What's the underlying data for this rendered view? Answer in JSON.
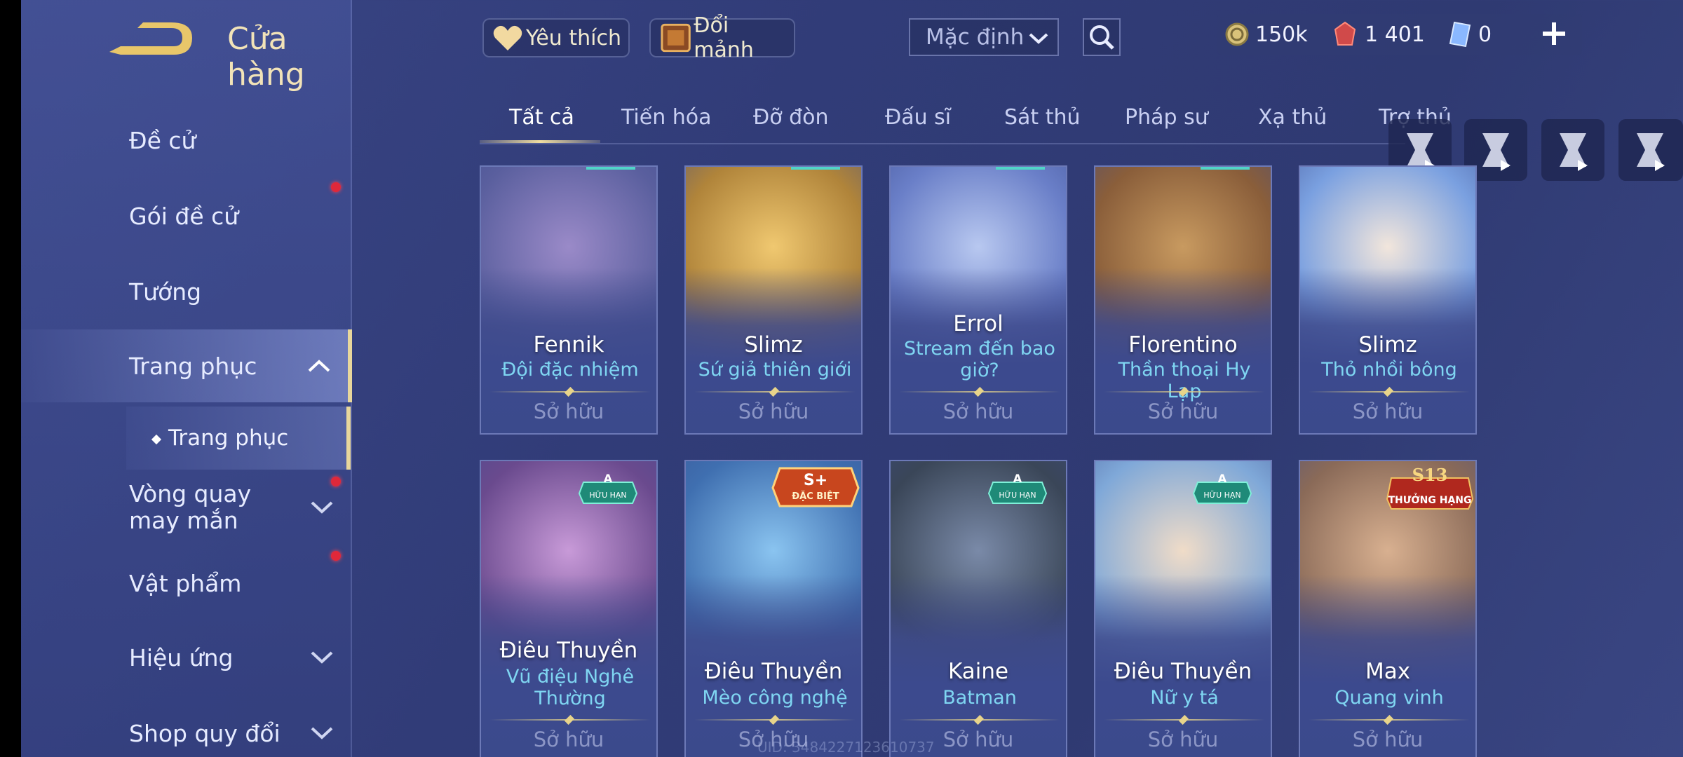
{
  "header": {
    "title": "Cửa hàng",
    "favorite_label": "Yêu thích",
    "exchange_label": "Đổi mảnh",
    "sort_value": "Mặc định",
    "currencies": {
      "gold": "150k",
      "vouchers": "1 401",
      "tokens": "0"
    }
  },
  "sidebar": {
    "items": [
      {
        "label": "Đề cử"
      },
      {
        "label": "Gói đề cử"
      },
      {
        "label": "Tướng"
      },
      {
        "label": "Trang phục"
      },
      {
        "label": "Vòng quay may mắn"
      },
      {
        "label": "Vật phẩm"
      },
      {
        "label": "Hiệu ứng"
      },
      {
        "label": "Shop quy đổi"
      }
    ],
    "sub_item": "Trang phục"
  },
  "tabs": [
    "Tất cả",
    "Tiến hóa",
    "Đỡ đòn",
    "Đấu sĩ",
    "Sát thủ",
    "Pháp sư",
    "Xạ thủ",
    "Trợ thủ"
  ],
  "cards": [
    {
      "hero": "Fennik",
      "skin": "Đội đặc nhiệm",
      "status": "Sở hữu",
      "color": "#5a5f9e"
    },
    {
      "hero": "Slimz",
      "skin": "Sứ giả thiên giới",
      "status": "Sở hữu",
      "color": "#b0843a"
    },
    {
      "hero": "Errol",
      "skin": "Stream đến bao giờ?",
      "status": "Sở hữu",
      "color": "#6a7fc8"
    },
    {
      "hero": "Florentino",
      "skin": "Thần thoại Hy Lạp",
      "status": "Sở hữu",
      "color": "#8a5e3a"
    },
    {
      "hero": "Slimz",
      "skin": "Thỏ nhồi bông",
      "status": "Sở hữu",
      "color": "#7aa0e0"
    },
    {
      "hero": "Điêu Thuyền",
      "skin": "Vũ điệu Nghê Thường",
      "status": "Sở hữu",
      "color": "#6a4a8e",
      "badge_title": "A",
      "badge_sub": "HỮU HẠN"
    },
    {
      "hero": "Điêu Thuyền",
      "skin": "Mèo công nghệ",
      "status": "Sở hữu",
      "color": "#3f6fb0",
      "badge_title": "S+",
      "badge_sub": "ĐẶC BIỆT"
    },
    {
      "hero": "Kaine",
      "skin": "Batman",
      "status": "Sở hữu",
      "color": "#3a4658",
      "badge_title": "A",
      "badge_sub": "HỮU HẠN"
    },
    {
      "hero": "Điêu Thuyền",
      "skin": "Nữ y tá",
      "status": "Sở hữu",
      "color": "#7fa8d8",
      "badge_title": "A",
      "badge_sub": "HỮU HẠN"
    },
    {
      "hero": "Max",
      "skin": "Quang vinh",
      "status": "Sở hữu",
      "color": "#8a6a58",
      "badge_title": "S13",
      "badge_sub": "THƯỞNG HẠNG"
    }
  ],
  "uid": "UID: 3484227123610737"
}
